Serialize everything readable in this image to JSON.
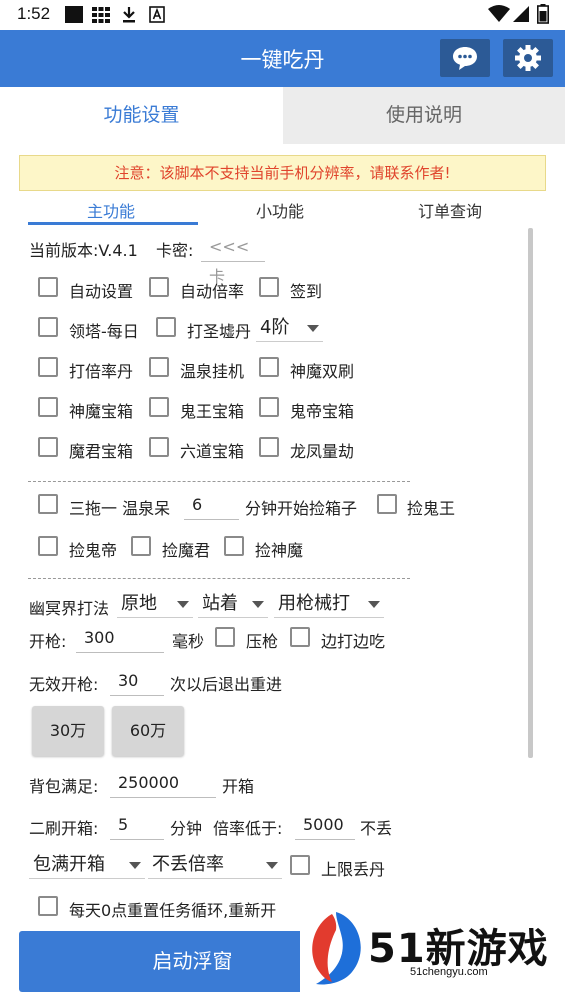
{
  "status_bar": {
    "time": "1:52"
  },
  "toolbar": {
    "title": "一键吃丹"
  },
  "main_tabs": [
    {
      "label": "功能设置"
    },
    {
      "label": "使用说明"
    }
  ],
  "warning": "注意：该脚本不支持当前手机分辨率，请联系作者!",
  "sub_tabs": [
    {
      "label": "主功能"
    },
    {
      "label": "小功能"
    },
    {
      "label": "订单查询"
    }
  ],
  "version": {
    "label": "当前版本:V.4.1",
    "key_label": "卡密:",
    "key_placeholder": "<<<卡"
  },
  "options": {
    "auto_settings": "自动设置",
    "auto_multiplier": "自动倍率",
    "sign_in": "签到",
    "tower_daily": "领塔-每日",
    "holy_furnace": "打圣墟丹",
    "holy_furnace_level": "4阶",
    "multiplier_pill": "打倍率丹",
    "hot_spring_idle": "温泉挂机",
    "god_demon_double": "神魔双刷",
    "god_demon_chest": "神魔宝箱",
    "ghost_king_chest": "鬼王宝箱",
    "ghost_emperor_chest": "鬼帝宝箱",
    "demon_lord_chest": "魔君宝箱",
    "six_paths_chest": "六道宝箱",
    "dragon_phoenix": "龙凤量劫"
  },
  "tow": {
    "label": "三拖一 温泉呆",
    "minutes": "6",
    "after": "分钟开始捡箱子",
    "pick_ghost_king": "捡鬼王",
    "pick_ghost_emperor": "捡鬼帝",
    "pick_demon_lord": "捡魔君",
    "pick_god_demon": "捡神魔"
  },
  "netherworld": {
    "label": "幽冥界打法",
    "mode1": "原地",
    "mode2": "站着",
    "mode3": "用枪械打",
    "fire_label": "开枪:",
    "fire_value": "300",
    "ms": "毫秒",
    "recoil": "压枪",
    "move_fire": "边打边吃",
    "invalid_label": "无效开枪:",
    "invalid_value": "30",
    "invalid_after": "次以后退出重进",
    "btn_30w": "30万",
    "btn_60w": "60万"
  },
  "bag": {
    "label": "背包满足:",
    "value": "250000",
    "after": "开箱"
  },
  "second": {
    "label": "二刷开箱:",
    "value": "5",
    "minutes": "分钟",
    "rate_label": "倍率低于:",
    "rate_value": "5000",
    "no_drop": "不丢",
    "full_open": "包满开箱",
    "no_drop_rate": "不丢倍率",
    "max_drop": "上限丢丹"
  },
  "daily_reset": "每天0点重置任务循环,重新开",
  "launch_button": "启动浮窗",
  "watermark": {
    "brand": "51新游戏",
    "url": "51chengyu.com"
  },
  "colors": {
    "accent": "#3a7bd5",
    "warning_text": "#e0442c",
    "warning_bg": "#fdf6c8"
  }
}
